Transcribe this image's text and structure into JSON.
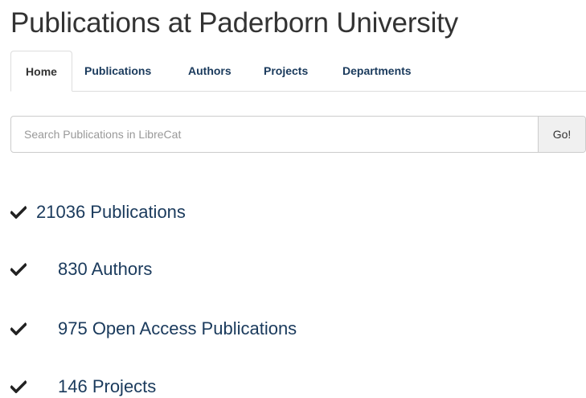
{
  "page": {
    "title": "Publications at Paderborn University"
  },
  "tabs": [
    {
      "label": "Home",
      "active": true
    },
    {
      "label": "Publications",
      "active": false
    },
    {
      "label": "Authors",
      "active": false
    },
    {
      "label": "Projects",
      "active": false
    },
    {
      "label": "Departments",
      "active": false
    }
  ],
  "search": {
    "placeholder": "Search Publications in LibreCat",
    "value": "",
    "button_label": "Go!"
  },
  "stats": [
    {
      "text": "21036 Publications",
      "icon": "check-icon"
    },
    {
      "text": "830 Authors",
      "icon": "check-icon"
    },
    {
      "text": "975 Open Access Publications",
      "icon": "check-icon"
    },
    {
      "text": "146 Projects",
      "icon": "check-icon"
    }
  ],
  "colors": {
    "link": "#1a3a5c",
    "text": "#333333",
    "border": "#dddddd",
    "button_bg": "#f0f0f0",
    "placeholder": "#999999"
  }
}
